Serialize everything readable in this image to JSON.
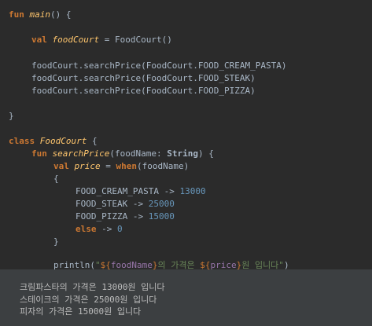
{
  "editor": {
    "lines": {
      "l1": {
        "kw": "fun ",
        "name": "main",
        "rest": "() {"
      },
      "l2": {
        "kw": "val ",
        "name": "foodCourt",
        "rest": " = FoodCourt()"
      },
      "l3": {
        "text": "foodCourt.searchPrice(FoodCourt.FOOD_CREAM_PASTA)"
      },
      "l4": {
        "text": "foodCourt.searchPrice(FoodCourt.FOOD_STEAK)"
      },
      "l5": {
        "text": "foodCourt.searchPrice(FoodCourt.FOOD_PIZZA)"
      },
      "l6": {
        "text": "}"
      },
      "l7": {
        "kw": "class ",
        "name": "FoodCourt",
        "rest": " {"
      },
      "l8": {
        "kw": "fun ",
        "name": "searchPrice",
        "p1": "(foodName: ",
        "type": "String",
        "p2": ") {"
      },
      "l9": {
        "kw": "val ",
        "name": "price",
        "eq": " = ",
        "kw2": "when",
        "rest": "(foodName)"
      },
      "l10": {
        "text": "{"
      },
      "l11": {
        "key": "FOOD_CREAM_PASTA -> ",
        "val": "13000"
      },
      "l12": {
        "key": "FOOD_STEAK -> ",
        "val": "25000"
      },
      "l13": {
        "key": "FOOD_PIZZA -> ",
        "val": "15000"
      },
      "l14": {
        "kw": "else",
        "arrow": " -> ",
        "val": "0"
      },
      "l15": {
        "text": "}"
      },
      "l16": {
        "fn": "println(",
        "q1": "\"",
        "t1": "${",
        "v1": "foodName",
        "t2": "}",
        "s1": "의 가격은 ",
        "t3": "${",
        "v2": "price",
        "t4": "}",
        "s2": "원 입니다\"",
        "close": ")"
      }
    }
  },
  "console": {
    "lines": [
      "크림파스타의 가격은 13000원 입니다",
      "스테이크의 가격은 25000원 입니다",
      "피자의 가격은 15000원 입니다"
    ]
  }
}
